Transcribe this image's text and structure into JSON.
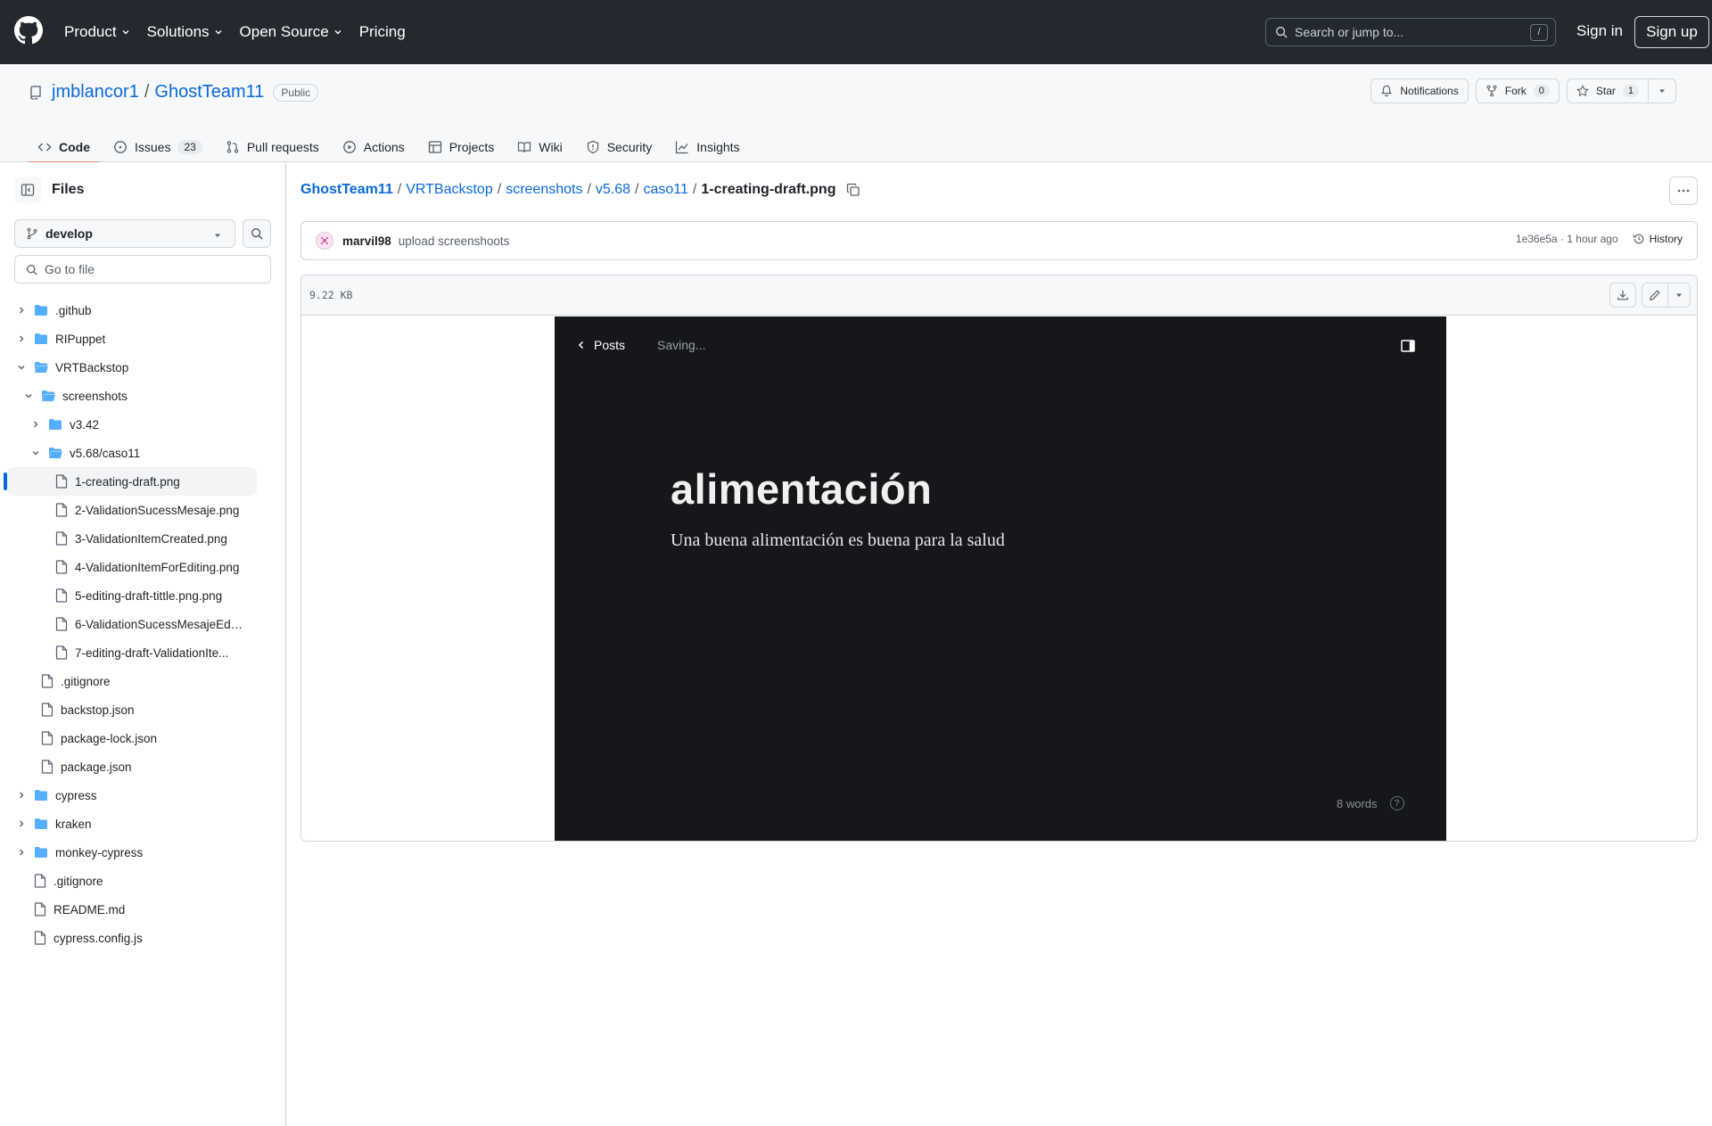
{
  "header": {
    "nav": [
      "Product",
      "Solutions",
      "Open Source",
      "Pricing"
    ],
    "search_placeholder": "Search or jump to...",
    "search_key": "/",
    "sign_in": "Sign in",
    "sign_up": "Sign up"
  },
  "repo": {
    "owner": "jmblancor1",
    "name": "GhostTeam11",
    "visibility": "Public",
    "notifications_label": "Notifications",
    "fork_label": "Fork",
    "fork_count": "0",
    "star_label": "Star",
    "star_count": "1"
  },
  "tabs": [
    {
      "label": "Code",
      "icon": "code-icon",
      "active": true
    },
    {
      "label": "Issues",
      "icon": "issue-icon",
      "count": "23"
    },
    {
      "label": "Pull requests",
      "icon": "pull-request-icon"
    },
    {
      "label": "Actions",
      "icon": "play-icon"
    },
    {
      "label": "Projects",
      "icon": "table-icon"
    },
    {
      "label": "Wiki",
      "icon": "book-icon"
    },
    {
      "label": "Security",
      "icon": "shield-icon"
    },
    {
      "label": "Insights",
      "icon": "graph-icon"
    }
  ],
  "sidebar": {
    "title": "Files",
    "branch": "develop",
    "goto_placeholder": "Go to file",
    "tree": [
      {
        "label": ".github",
        "type": "folder",
        "depth": 0,
        "expanded": false
      },
      {
        "label": "RIPuppet",
        "type": "folder",
        "depth": 0,
        "expanded": false
      },
      {
        "label": "VRTBackstop",
        "type": "folder",
        "depth": 0,
        "expanded": true
      },
      {
        "label": "screenshots",
        "type": "folder",
        "depth": 1,
        "expanded": true
      },
      {
        "label": "v3.42",
        "type": "folder",
        "depth": 2,
        "expanded": false
      },
      {
        "label": "v5.68/caso11",
        "type": "folder",
        "depth": 2,
        "expanded": true
      },
      {
        "label": "1-creating-draft.png",
        "type": "file",
        "depth": 3,
        "selected": true
      },
      {
        "label": "2-ValidationSucessMesaje.png",
        "type": "file",
        "depth": 3
      },
      {
        "label": "3-ValidationItemCreated.png",
        "type": "file",
        "depth": 3
      },
      {
        "label": "4-ValidationItemForEditing.png",
        "type": "file",
        "depth": 3
      },
      {
        "label": "5-editing-draft-tittle.png.png",
        "type": "file",
        "depth": 3
      },
      {
        "label": "6-ValidationSucessMesajeEdit...",
        "type": "file",
        "depth": 3
      },
      {
        "label": "7-editing-draft-ValidationIte...",
        "type": "file",
        "depth": 3
      },
      {
        "label": ".gitignore",
        "type": "file",
        "depth": 1
      },
      {
        "label": "backstop.json",
        "type": "file",
        "depth": 1
      },
      {
        "label": "package-lock.json",
        "type": "file",
        "depth": 1
      },
      {
        "label": "package.json",
        "type": "file",
        "depth": 1
      },
      {
        "label": "cypress",
        "type": "folder",
        "depth": 0,
        "expanded": false
      },
      {
        "label": "kraken",
        "type": "folder",
        "depth": 0,
        "expanded": false
      },
      {
        "label": "monkey-cypress",
        "type": "folder",
        "depth": 0,
        "expanded": false
      },
      {
        "label": ".gitignore",
        "type": "file",
        "depth": 0
      },
      {
        "label": "README.md",
        "type": "file",
        "depth": 0
      },
      {
        "label": "cypress.config.js",
        "type": "file",
        "depth": 0
      }
    ]
  },
  "breadcrumb": {
    "parts": [
      "GhostTeam11",
      "VRTBackstop",
      "screenshots",
      "v5.68",
      "caso11"
    ],
    "current": "1-creating-draft.png"
  },
  "commit": {
    "author": "marvil98",
    "message": "upload screenshoots",
    "meta": "1e36e5a · 1 hour ago",
    "history_label": "History"
  },
  "file": {
    "size": "9.22 KB"
  },
  "preview": {
    "back_label": "Posts",
    "status": "Saving...",
    "title": "alimentación",
    "body": "Una buena alimentación es buena para la salud",
    "word_count": "8 words",
    "help": "?"
  },
  "colors": {
    "header_bg": "#24292f",
    "link": "#0969da",
    "active_tab": "#fd8c73",
    "folder": "#54aeff",
    "preview_bg": "#15171a"
  }
}
